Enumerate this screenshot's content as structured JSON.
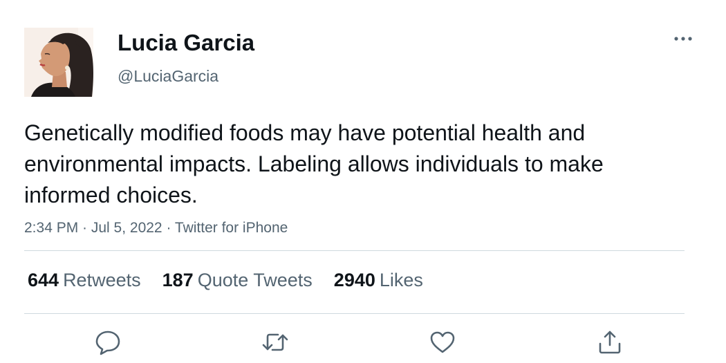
{
  "author": {
    "display_name": "Lucia Garcia",
    "handle": "@LuciaGarcia"
  },
  "tweet": {
    "text": "Genetically modified foods may have potential health and environmental impacts. Labeling allows individuals to make informed choices.",
    "meta": "2:34 PM · Jul 5, 2022 · Twitter for iPhone"
  },
  "stats": {
    "retweets_count": "644",
    "retweets_label": "Retweets",
    "quotes_count": "187",
    "quotes_label": "Quote Tweets",
    "likes_count": "2940",
    "likes_label": "Likes"
  },
  "icons": {
    "more": "more-horizontal-icon",
    "reply": "reply-icon",
    "retweet": "retweet-icon",
    "like": "heart-icon",
    "share": "share-icon"
  },
  "colors": {
    "text": "#0f1419",
    "secondary": "#536471",
    "divider": "#cfd9de"
  }
}
